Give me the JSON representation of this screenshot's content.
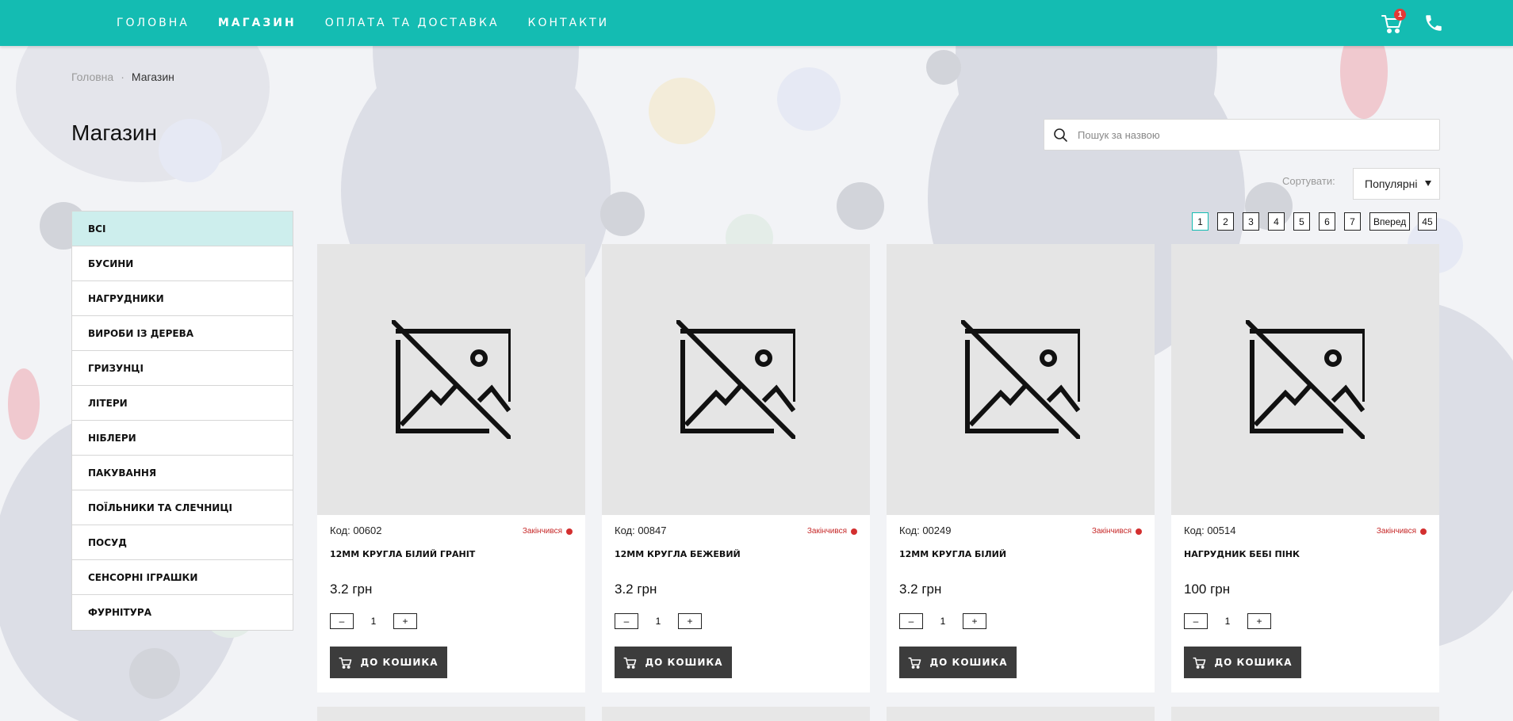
{
  "nav": {
    "items": [
      {
        "label": "ГОЛОВНА",
        "active": false
      },
      {
        "label": "МАГАЗИН",
        "active": true
      },
      {
        "label": "ОПЛАТА ТА ДОСТАВКА",
        "active": false
      },
      {
        "label": "КОНТАКТИ",
        "active": false
      }
    ],
    "cart_count": "1",
    "cart_icon": "cart-icon",
    "phone_icon": "phone-icon"
  },
  "breadcrumb": {
    "home": "Головна",
    "separator": "·",
    "current": "Магазин"
  },
  "page": {
    "title": "Магазин"
  },
  "search": {
    "placeholder": "Пошук за назвою",
    "value": ""
  },
  "sort": {
    "label": "Сортувати:",
    "selected": "Популярні"
  },
  "pagination": {
    "pages": [
      "1",
      "2",
      "3",
      "4",
      "5",
      "6",
      "7"
    ],
    "active": "1",
    "next_label": "Вперед",
    "last_label": "45"
  },
  "sidebar": {
    "categories": [
      {
        "label": "ВСІ",
        "active": true
      },
      {
        "label": "БУСИНИ",
        "active": false
      },
      {
        "label": "НАГРУДНИКИ",
        "active": false
      },
      {
        "label": "ВИРОБИ ІЗ ДЕРЕВА",
        "active": false
      },
      {
        "label": "ГРИЗУНЦІ",
        "active": false
      },
      {
        "label": "ЛІТЕРИ",
        "active": false
      },
      {
        "label": "НІБЛЕРИ",
        "active": false
      },
      {
        "label": "ПАКУВАННЯ",
        "active": false
      },
      {
        "label": "ПОЇЛЬНИКИ ТА СЛЕЧНИЦІ",
        "active": false
      },
      {
        "label": "ПОСУД",
        "active": false
      },
      {
        "label": "СЕНСОРНІ ІГРАШКИ",
        "active": false
      },
      {
        "label": "ФУРНІТУРА",
        "active": false
      }
    ]
  },
  "products": [
    {
      "code": "Код: 00602",
      "stock": "Закінчився",
      "name": "12ММ КРУГЛА БІЛИЙ ГРАНІТ",
      "price": "3.2 грн",
      "qty": "1",
      "add_label": "ДО КОШИКА"
    },
    {
      "code": "Код: 00847",
      "stock": "Закінчився",
      "name": "12ММ КРУГЛА БЕЖЕВИЙ",
      "price": "3.2 грн",
      "qty": "1",
      "add_label": "ДО КОШИКА"
    },
    {
      "code": "Код: 00249",
      "stock": "Закінчився",
      "name": "12ММ КРУГЛА БІЛИЙ",
      "price": "3.2 грн",
      "qty": "1",
      "add_label": "ДО КОШИКА"
    },
    {
      "code": "Код: 00514",
      "stock": "Закінчився",
      "name": "НАГРУДНИК БЕБІ ПІНК",
      "price": "100 грн",
      "qty": "1",
      "add_label": "ДО КОШИКА"
    }
  ],
  "qty_controls": {
    "minus": "–",
    "plus": "+"
  },
  "colors": {
    "brand": "#14bcb2",
    "active_category": "#cdeeed",
    "add_button": "#3c3c3c",
    "out_of_stock": "#d32f2f"
  }
}
